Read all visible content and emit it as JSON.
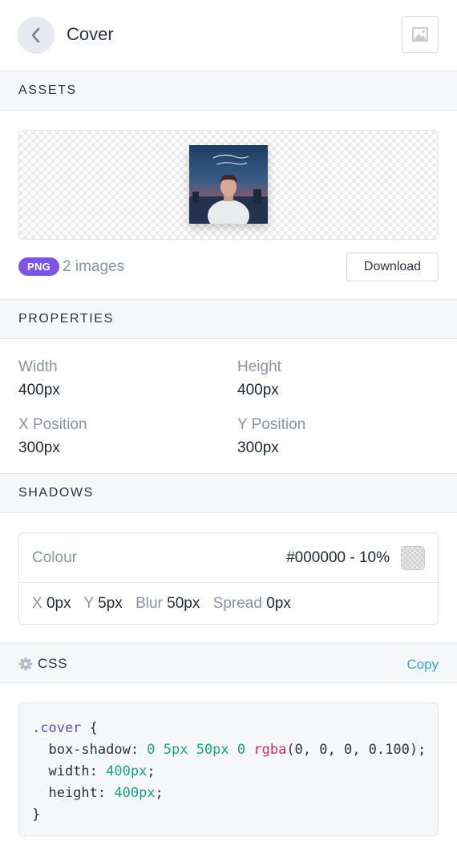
{
  "header": {
    "title": "Cover",
    "back_icon": "chevron-left-icon",
    "image_icon": "image-icon"
  },
  "sections": {
    "assets": "ASSETS",
    "properties": "PROPERTIES",
    "shadows": "SHADOWS",
    "css": "CSS"
  },
  "assets": {
    "format_badge": "PNG",
    "image_count": "2 images",
    "download_label": "Download",
    "preview_icon": "album-cover-image"
  },
  "properties": {
    "width_label": "Width",
    "width_value": "400px",
    "height_label": "Height",
    "height_value": "400px",
    "x_label": "X Position",
    "x_value": "300px",
    "y_label": "Y Position",
    "y_value": "300px"
  },
  "shadows": {
    "colour_label": "Colour",
    "colour_value": "#000000 - 10%",
    "x_label": "X",
    "x_value": "0px",
    "y_label": "Y",
    "y_value": "5px",
    "blur_label": "Blur",
    "blur_value": "50px",
    "spread_label": "Spread",
    "spread_value": "0px"
  },
  "css": {
    "copy_label": "Copy",
    "code": {
      "selector": ".cover",
      "open_brace": " {",
      "line1_prop": "  box-shadow: ",
      "line1_nums": "0 5px 50px 0 ",
      "line1_fn": "rgba",
      "line1_args": "(0, 0, 0, 0.100);",
      "line2_prop": "  width: ",
      "line2_val": "400px",
      "line3_prop": "  height: ",
      "line3_val": "400px",
      "semicolon": ";",
      "close_brace": "}"
    }
  },
  "colors": {
    "accent_purple": "#7d55e6",
    "link_blue": "#2fa8e0",
    "code_number": "#1aa187",
    "code_function": "#d5286d",
    "code_selector": "#5b4fc7",
    "section_bg": "#f6f7f9"
  }
}
